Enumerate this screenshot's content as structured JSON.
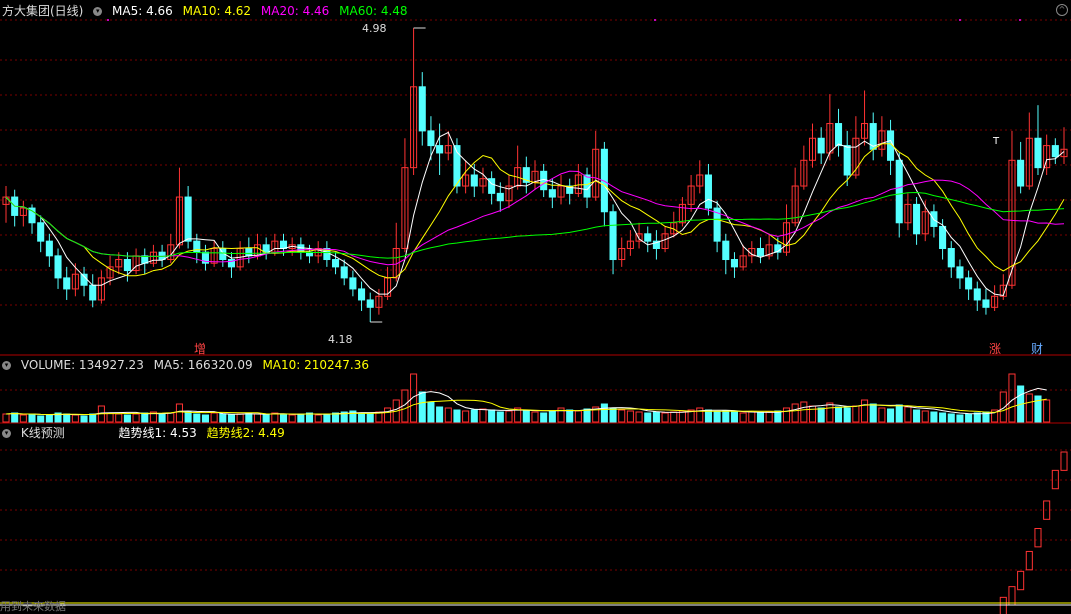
{
  "header": {
    "stock_name": "方大集团(日线)",
    "ma5": "MA5: 4.66",
    "ma10": "MA10: 4.62",
    "ma20": "MA20: 4.46",
    "ma60": "MA60: 4.48"
  },
  "volume_header": {
    "volume": "VOLUME: 134927.23",
    "ma5": "MA5: 166320.09",
    "ma10": "MA10: 210247.36"
  },
  "indicator_header": {
    "name": "K线预测",
    "trend1": "趋势线1: 4.53",
    "trend2": "趋势线2: 4.49"
  },
  "annotations": {
    "high_label": "4.98",
    "low_label": "4.18",
    "tag_zeng": "增",
    "tag_zhang": "涨",
    "tag_cai": "财",
    "marker_t": "T"
  },
  "footer": {
    "text": "用到未来数据"
  },
  "colors": {
    "up": "#ff3333",
    "down": "#54ffff",
    "ma5": "#ffffff",
    "ma10": "#ffff00",
    "ma20": "#ff00ff",
    "ma60": "#00ff00",
    "grid": "#7a0000",
    "separator": "#b00000"
  },
  "chart_data": {
    "type": "candlestick",
    "price_range": [
      4.18,
      4.98
    ],
    "candles": [
      [
        4.5,
        4.52,
        4.45,
        4.55
      ],
      [
        4.52,
        4.47,
        4.44,
        4.54
      ],
      [
        4.47,
        4.49,
        4.44,
        4.51
      ],
      [
        4.49,
        4.45,
        4.42,
        4.5
      ],
      [
        4.45,
        4.4,
        4.37,
        4.47
      ],
      [
        4.4,
        4.36,
        4.33,
        4.42
      ],
      [
        4.36,
        4.3,
        4.27,
        4.38
      ],
      [
        4.3,
        4.27,
        4.24,
        4.33
      ],
      [
        4.27,
        4.31,
        4.25,
        4.34
      ],
      [
        4.31,
        4.28,
        4.25,
        4.33
      ],
      [
        4.28,
        4.24,
        4.22,
        4.31
      ],
      [
        4.24,
        4.3,
        4.23,
        4.32
      ],
      [
        4.3,
        4.33,
        4.28,
        4.36
      ],
      [
        4.33,
        4.35,
        4.31,
        4.37
      ],
      [
        4.35,
        4.32,
        4.29,
        4.37
      ],
      [
        4.32,
        4.36,
        4.31,
        4.38
      ],
      [
        4.36,
        4.34,
        4.31,
        4.38
      ],
      [
        4.34,
        4.37,
        4.33,
        4.39
      ],
      [
        4.37,
        4.35,
        4.33,
        4.39
      ],
      [
        4.35,
        4.39,
        4.34,
        4.42
      ],
      [
        4.39,
        4.52,
        4.38,
        4.6
      ],
      [
        4.52,
        4.4,
        4.38,
        4.55
      ],
      [
        4.4,
        4.37,
        4.34,
        4.42
      ],
      [
        4.37,
        4.34,
        4.32,
        4.39
      ],
      [
        4.34,
        4.38,
        4.33,
        4.4
      ],
      [
        4.38,
        4.35,
        4.33,
        4.4
      ],
      [
        4.35,
        4.33,
        4.3,
        4.37
      ],
      [
        4.33,
        4.38,
        4.32,
        4.4
      ],
      [
        4.38,
        4.36,
        4.34,
        4.41
      ],
      [
        4.36,
        4.39,
        4.35,
        4.42
      ],
      [
        4.39,
        4.37,
        4.35,
        4.41
      ],
      [
        4.37,
        4.4,
        4.36,
        4.42
      ],
      [
        4.4,
        4.38,
        4.36,
        4.42
      ],
      [
        4.38,
        4.39,
        4.36,
        4.41
      ],
      [
        4.39,
        4.37,
        4.35,
        4.41
      ],
      [
        4.37,
        4.36,
        4.34,
        4.39
      ],
      [
        4.36,
        4.38,
        4.34,
        4.4
      ],
      [
        4.38,
        4.35,
        4.33,
        4.4
      ],
      [
        4.35,
        4.33,
        4.31,
        4.37
      ],
      [
        4.33,
        4.3,
        4.28,
        4.35
      ],
      [
        4.3,
        4.27,
        4.25,
        4.32
      ],
      [
        4.27,
        4.24,
        4.21,
        4.29
      ],
      [
        4.24,
        4.22,
        4.18,
        4.26
      ],
      [
        4.22,
        4.25,
        4.2,
        4.27
      ],
      [
        4.25,
        4.3,
        4.24,
        4.33
      ],
      [
        4.3,
        4.38,
        4.29,
        4.45
      ],
      [
        4.38,
        4.6,
        4.37,
        4.68
      ],
      [
        4.6,
        4.82,
        4.58,
        4.98
      ],
      [
        4.82,
        4.7,
        4.66,
        4.86
      ],
      [
        4.7,
        4.66,
        4.62,
        4.74
      ],
      [
        4.66,
        4.64,
        4.58,
        4.72
      ],
      [
        4.64,
        4.66,
        4.62,
        4.7
      ],
      [
        4.66,
        4.55,
        4.53,
        4.68
      ],
      [
        4.55,
        4.58,
        4.53,
        4.62
      ],
      [
        4.58,
        4.55,
        4.52,
        4.61
      ],
      [
        4.55,
        4.57,
        4.53,
        4.6
      ],
      [
        4.57,
        4.53,
        4.5,
        4.59
      ],
      [
        4.53,
        4.51,
        4.48,
        4.56
      ],
      [
        4.51,
        4.55,
        4.49,
        4.58
      ],
      [
        4.55,
        4.6,
        4.54,
        4.66
      ],
      [
        4.6,
        4.56,
        4.53,
        4.63
      ],
      [
        4.56,
        4.59,
        4.54,
        4.62
      ],
      [
        4.59,
        4.54,
        4.52,
        4.61
      ],
      [
        4.54,
        4.52,
        4.49,
        4.57
      ],
      [
        4.52,
        4.55,
        4.5,
        4.58
      ],
      [
        4.55,
        4.53,
        4.5,
        4.57
      ],
      [
        4.53,
        4.58,
        4.52,
        4.61
      ],
      [
        4.58,
        4.52,
        4.49,
        4.6
      ],
      [
        4.52,
        4.65,
        4.51,
        4.7
      ],
      [
        4.65,
        4.48,
        4.44,
        4.67
      ],
      [
        4.48,
        4.35,
        4.31,
        4.5
      ],
      [
        4.35,
        4.38,
        4.33,
        4.41
      ],
      [
        4.38,
        4.4,
        4.36,
        4.43
      ],
      [
        4.4,
        4.42,
        4.38,
        4.45
      ],
      [
        4.42,
        4.4,
        4.37,
        4.44
      ],
      [
        4.4,
        4.38,
        4.35,
        4.43
      ],
      [
        4.38,
        4.42,
        4.37,
        4.44
      ],
      [
        4.42,
        4.45,
        4.41,
        4.48
      ],
      [
        4.45,
        4.5,
        4.44,
        4.52
      ],
      [
        4.5,
        4.55,
        4.48,
        4.58
      ],
      [
        4.55,
        4.58,
        4.53,
        4.62
      ],
      [
        4.58,
        4.49,
        4.47,
        4.61
      ],
      [
        4.49,
        4.4,
        4.37,
        4.51
      ],
      [
        4.4,
        4.35,
        4.31,
        4.42
      ],
      [
        4.35,
        4.33,
        4.3,
        4.37
      ],
      [
        4.33,
        4.36,
        4.32,
        4.39
      ],
      [
        4.36,
        4.38,
        4.34,
        4.4
      ],
      [
        4.38,
        4.36,
        4.34,
        4.41
      ],
      [
        4.36,
        4.39,
        4.35,
        4.42
      ],
      [
        4.39,
        4.37,
        4.35,
        4.41
      ],
      [
        4.37,
        4.45,
        4.36,
        4.5
      ],
      [
        4.45,
        4.55,
        4.44,
        4.6
      ],
      [
        4.55,
        4.62,
        4.54,
        4.66
      ],
      [
        4.62,
        4.68,
        4.6,
        4.72
      ],
      [
        4.68,
        4.64,
        4.61,
        4.71
      ],
      [
        4.64,
        4.72,
        4.62,
        4.8
      ],
      [
        4.72,
        4.66,
        4.63,
        4.76
      ],
      [
        4.66,
        4.58,
        4.55,
        4.7
      ],
      [
        4.58,
        4.68,
        4.57,
        4.74
      ],
      [
        4.68,
        4.72,
        4.66,
        4.81
      ],
      [
        4.72,
        4.65,
        4.62,
        4.75
      ],
      [
        4.65,
        4.7,
        4.63,
        4.74
      ],
      [
        4.7,
        4.62,
        4.58,
        4.73
      ],
      [
        4.62,
        4.45,
        4.41,
        4.64
      ],
      [
        4.45,
        4.5,
        4.43,
        4.53
      ],
      [
        4.5,
        4.42,
        4.39,
        4.52
      ],
      [
        4.42,
        4.48,
        4.4,
        4.51
      ],
      [
        4.48,
        4.44,
        4.41,
        4.5
      ],
      [
        4.44,
        4.38,
        4.35,
        4.46
      ],
      [
        4.38,
        4.33,
        4.3,
        4.4
      ],
      [
        4.33,
        4.3,
        4.27,
        4.35
      ],
      [
        4.3,
        4.27,
        4.24,
        4.32
      ],
      [
        4.27,
        4.24,
        4.21,
        4.29
      ],
      [
        4.24,
        4.22,
        4.2,
        4.27
      ],
      [
        4.22,
        4.25,
        4.21,
        4.28
      ],
      [
        4.25,
        4.28,
        4.24,
        4.31
      ],
      [
        4.28,
        4.62,
        4.27,
        4.7
      ],
      [
        4.62,
        4.55,
        4.53,
        4.67
      ],
      [
        4.55,
        4.68,
        4.54,
        4.75
      ],
      [
        4.68,
        4.6,
        4.58,
        4.77
      ],
      [
        4.6,
        4.66,
        4.58,
        4.69
      ],
      [
        4.66,
        4.63,
        4.61,
        4.68
      ],
      [
        4.63,
        4.65,
        4.61,
        4.71
      ]
    ],
    "volume": [
      8,
      9,
      7,
      8,
      6,
      7,
      9,
      8,
      7,
      6,
      8,
      16,
      9,
      8,
      7,
      8,
      9,
      10,
      8,
      9,
      18,
      10,
      8,
      7,
      9,
      8,
      7,
      8,
      9,
      8,
      7,
      9,
      8,
      7,
      8,
      9,
      7,
      8,
      9,
      10,
      11,
      9,
      8,
      10,
      14,
      22,
      32,
      48,
      30,
      20,
      15,
      14,
      12,
      11,
      12,
      13,
      12,
      10,
      11,
      14,
      12,
      10,
      9,
      11,
      14,
      12,
      11,
      13,
      15,
      18,
      14,
      12,
      11,
      10,
      9,
      10,
      9,
      10,
      11,
      12,
      14,
      12,
      10,
      11,
      10,
      9,
      10,
      9,
      10,
      11,
      14,
      18,
      20,
      16,
      14,
      19,
      15,
      14,
      16,
      22,
      18,
      14,
      13,
      17,
      15,
      12,
      11,
      10,
      9,
      8,
      7,
      8,
      9,
      10,
      12,
      30,
      48,
      36,
      28,
      26,
      22
    ],
    "indicator_values": [
      0,
      0,
      0,
      0,
      0,
      0,
      0,
      0,
      0,
      0,
      0,
      0,
      0,
      0,
      0,
      0,
      0,
      0,
      0,
      0,
      0,
      0,
      0,
      0,
      0,
      0,
      0,
      0,
      0,
      0,
      0,
      0,
      0,
      0,
      0,
      0,
      0,
      0,
      0,
      0,
      0,
      0,
      0,
      0,
      0,
      0,
      0,
      0,
      0,
      0,
      0,
      0,
      0,
      0,
      0,
      0,
      0,
      0,
      0,
      0,
      0,
      0,
      0,
      0,
      0,
      0,
      0,
      0,
      0,
      0,
      0,
      0,
      0,
      0,
      0,
      0,
      0,
      0,
      0,
      0,
      0,
      0,
      0,
      0,
      0,
      0,
      0,
      0,
      0,
      0,
      0,
      0,
      0,
      0,
      0,
      0,
      0,
      0,
      0,
      0,
      0,
      0,
      0,
      0,
      0,
      0,
      0,
      0,
      0,
      0,
      0,
      0,
      0,
      0,
      0,
      0.05,
      0.12,
      0.22,
      0.35,
      0.5,
      0.68,
      0.88,
      1
    ]
  }
}
